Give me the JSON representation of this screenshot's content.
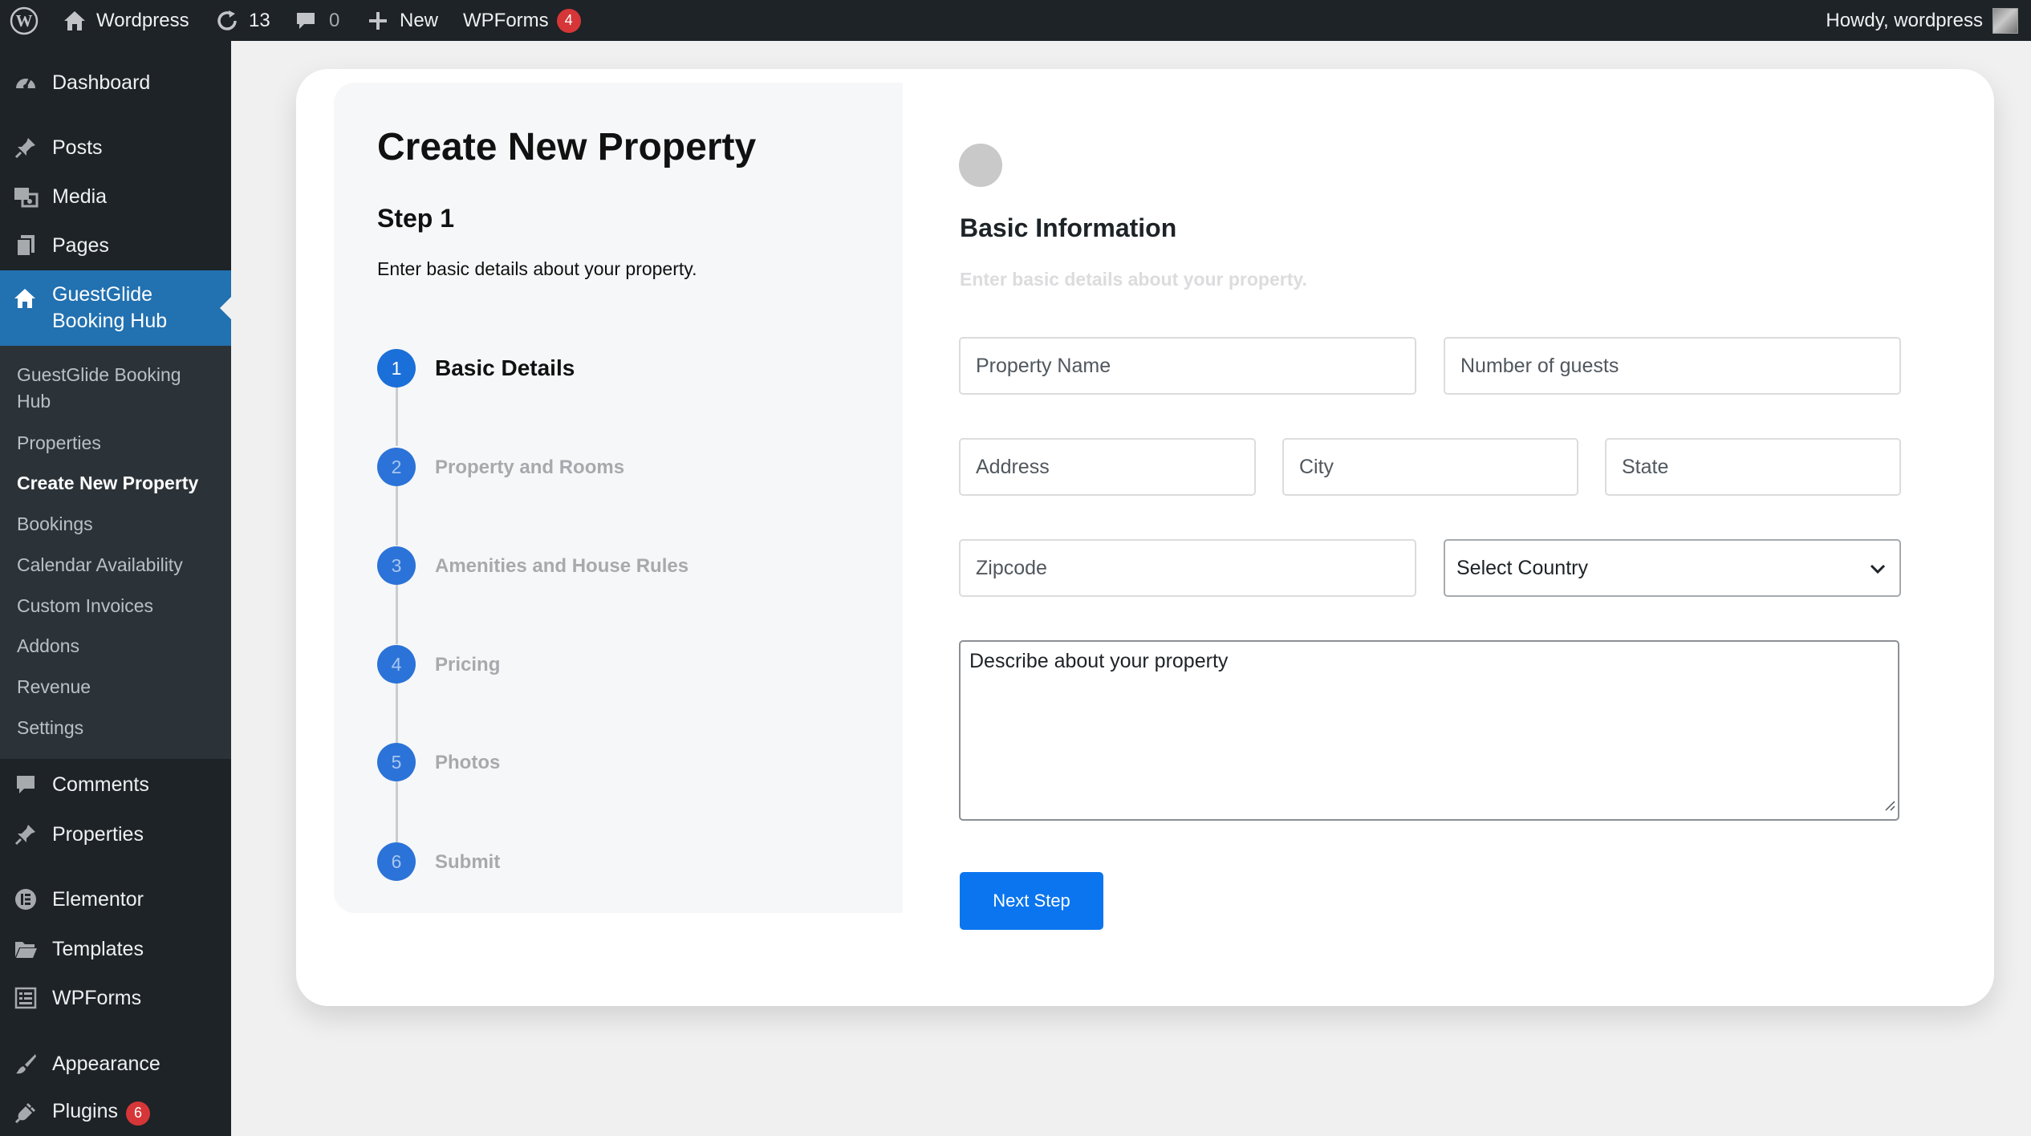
{
  "admin_bar": {
    "site_name": "Wordpress",
    "updates_count": "13",
    "comments_count": "0",
    "new_label": "New",
    "wpforms_label": "WPForms",
    "wpforms_badge": "4",
    "greeting": "Howdy, wordpress"
  },
  "sidebar": {
    "items": {
      "dashboard": "Dashboard",
      "posts": "Posts",
      "media": "Media",
      "pages": "Pages",
      "guestglide": "GuestGlide Booking Hub",
      "comments": "Comments",
      "properties": "Properties",
      "elementor": "Elementor",
      "templates": "Templates",
      "wpforms": "WPForms",
      "appearance": "Appearance",
      "plugins": "Plugins",
      "plugins_badge": "6"
    },
    "submenu": [
      "GuestGlide Booking Hub",
      "Properties",
      "Create New Property",
      "Bookings",
      "Calendar Availability",
      "Custom Invoices",
      "Addons",
      "Revenue",
      "Settings"
    ],
    "current_submenu": "Create New Property"
  },
  "wizard": {
    "title": "Create New Property",
    "step_label": "Step 1",
    "step_description": "Enter basic details about your property.",
    "steps": [
      {
        "num": "1",
        "name": "Basic Details",
        "active": true
      },
      {
        "num": "2",
        "name": "Property and Rooms",
        "active": false
      },
      {
        "num": "3",
        "name": "Amenities and House Rules",
        "active": false
      },
      {
        "num": "4",
        "name": "Pricing",
        "active": false
      },
      {
        "num": "5",
        "name": "Photos",
        "active": false
      },
      {
        "num": "6",
        "name": "Submit",
        "active": false
      }
    ]
  },
  "form": {
    "section_title": "Basic Information",
    "section_subtitle": "Enter basic details about your property.",
    "placeholders": {
      "property_name": "Property Name",
      "guests": "Number of guests",
      "address": "Address",
      "city": "City",
      "state": "State",
      "zipcode": "Zipcode",
      "description": "Describe about your property"
    },
    "country_selected": "Select Country",
    "next_button": "Next Step"
  },
  "colors": {
    "admin_bg": "#1d2327",
    "menu_active": "#2271b1",
    "step_blue": "#1a6fd9",
    "button_blue": "#0b75ef",
    "badge_red": "#d63638"
  },
  "icons": [
    "wordpress-logo-icon",
    "home-icon",
    "updates-icon",
    "comments-icon",
    "plus-icon",
    "dashboard-icon",
    "pin-icon",
    "media-icon",
    "pages-icon",
    "house-icon",
    "comment-bubble-icon",
    "elementor-icon",
    "folder-icon",
    "form-icon",
    "brush-icon",
    "plug-icon",
    "chevron-down-icon",
    "resize-grip-icon"
  ]
}
